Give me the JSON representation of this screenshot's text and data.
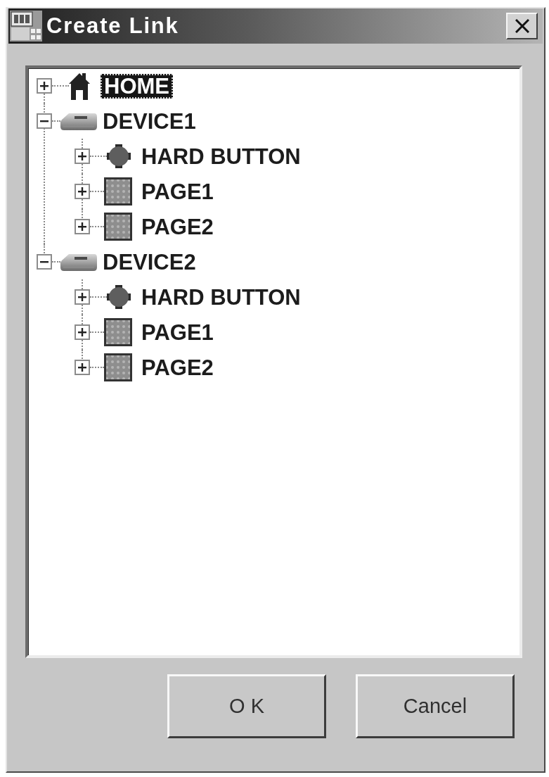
{
  "window": {
    "title": "Create Link"
  },
  "tree": {
    "items": [
      {
        "kind": "home",
        "label": "HOME",
        "expanded": false,
        "selected": true
      },
      {
        "kind": "device",
        "label": "DEVICE1",
        "expanded": true,
        "selected": false,
        "children": [
          {
            "kind": "button",
            "label": "HARD BUTTON",
            "expanded": false,
            "selected": false
          },
          {
            "kind": "page",
            "label": "PAGE1",
            "expanded": false,
            "selected": false
          },
          {
            "kind": "page",
            "label": "PAGE2",
            "expanded": false,
            "selected": false
          }
        ]
      },
      {
        "kind": "device",
        "label": "DEVICE2",
        "expanded": true,
        "selected": false,
        "children": [
          {
            "kind": "button",
            "label": "HARD BUTTON",
            "expanded": false,
            "selected": false
          },
          {
            "kind": "page",
            "label": "PAGE1",
            "expanded": false,
            "selected": false
          },
          {
            "kind": "page",
            "label": "PAGE2",
            "expanded": false,
            "selected": false
          }
        ]
      }
    ]
  },
  "buttons": [
    {
      "label": "O K"
    },
    {
      "label": "Cancel"
    }
  ]
}
